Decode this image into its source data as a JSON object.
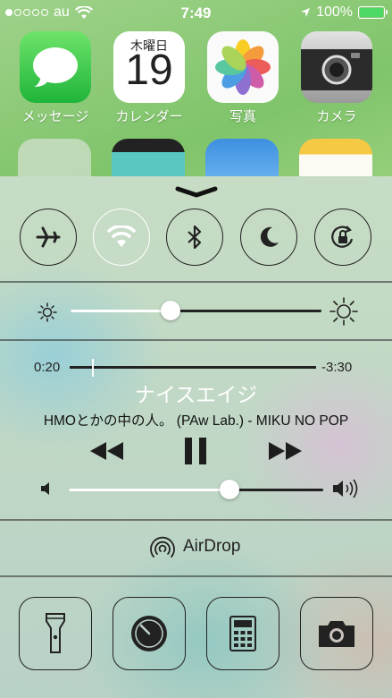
{
  "status_bar": {
    "carrier": "au",
    "time": "7:49",
    "battery_percent": "100%",
    "signal_bars_filled": 1,
    "signal_bars_total": 5
  },
  "home_apps": [
    {
      "label": "メッセージ",
      "icon": "messages-icon"
    },
    {
      "label": "カレンダー",
      "icon": "calendar-icon",
      "weekday": "木曜日",
      "day": "19"
    },
    {
      "label": "写真",
      "icon": "photos-icon"
    },
    {
      "label": "カメラ",
      "icon": "camera-icon"
    }
  ],
  "control_center": {
    "toggles": [
      {
        "name": "airplane-mode",
        "on": false
      },
      {
        "name": "wifi",
        "on": true
      },
      {
        "name": "bluetooth",
        "on": false
      },
      {
        "name": "do-not-disturb",
        "on": false
      },
      {
        "name": "rotation-lock",
        "on": false
      }
    ],
    "brightness_level": 0.4,
    "now_playing": {
      "elapsed": "0:20",
      "remaining": "-3:30",
      "progress": 0.09,
      "title": "ナイスエイジ",
      "subtitle": "HMOとかの中の人。 (PAw Lab.) - MIKU NO POP",
      "playing": true
    },
    "volume_level": 0.63,
    "airdrop_label": "AirDrop",
    "shortcuts": [
      "flashlight-icon",
      "timer-icon",
      "calculator-icon",
      "camera-icon"
    ]
  },
  "colors": {
    "wifi_active": "#ffffff",
    "battery_fill": "#4cd964",
    "messages": "#2dbd44"
  }
}
